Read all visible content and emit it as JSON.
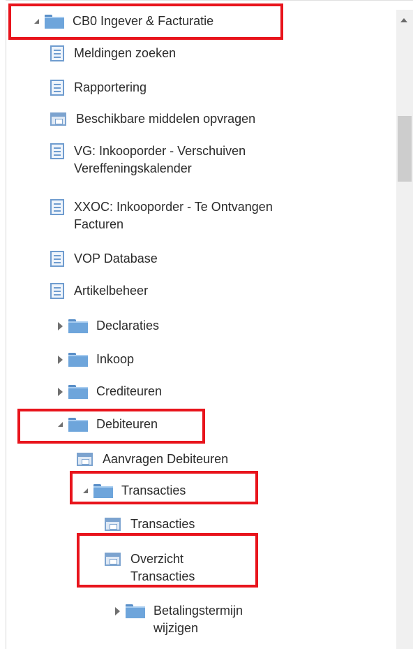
{
  "tree": {
    "root": {
      "label": "CB0 Ingever & Facturatie",
      "expanded": true,
      "icon": "folder-icon"
    },
    "items": [
      {
        "label": "Meldingen zoeken",
        "icon": "document-icon"
      },
      {
        "label": "Rapportering",
        "icon": "document-icon"
      },
      {
        "label": "Beschikbare middelen opvragen",
        "icon": "form-icon"
      },
      {
        "label": "VG: Inkooporder - Verschuiven\nVereffeningskalender",
        "icon": "document-icon"
      },
      {
        "label": "XXOC: Inkooporder - Te Ontvangen\nFacturen",
        "icon": "document-icon"
      },
      {
        "label": "VOP Database",
        "icon": "document-icon"
      },
      {
        "label": "Artikelbeheer",
        "icon": "document-icon"
      }
    ],
    "folders": [
      {
        "label": "Declaraties",
        "expanded": false,
        "icon": "folder-icon"
      },
      {
        "label": "Inkoop",
        "expanded": false,
        "icon": "folder-icon"
      },
      {
        "label": "Crediteuren",
        "expanded": false,
        "icon": "folder-icon"
      }
    ],
    "debiteuren": {
      "label": "Debiteuren",
      "expanded": true,
      "icon": "folder-icon",
      "aanvragen": {
        "label": "Aanvragen Debiteuren",
        "icon": "form-icon"
      },
      "transacties_folder": {
        "label": "Transacties",
        "expanded": true,
        "icon": "folder-icon",
        "items": [
          {
            "label": "Transacties",
            "icon": "form-icon"
          },
          {
            "label": "Overzicht\nTransacties",
            "icon": "form-icon"
          }
        ]
      },
      "betalingstermijn": {
        "label": "Betalingstermijn\nwijzigen",
        "expanded": false,
        "icon": "folder-icon"
      }
    }
  },
  "highlight_color": "#e8141c",
  "folder_color": "#6ea5db"
}
